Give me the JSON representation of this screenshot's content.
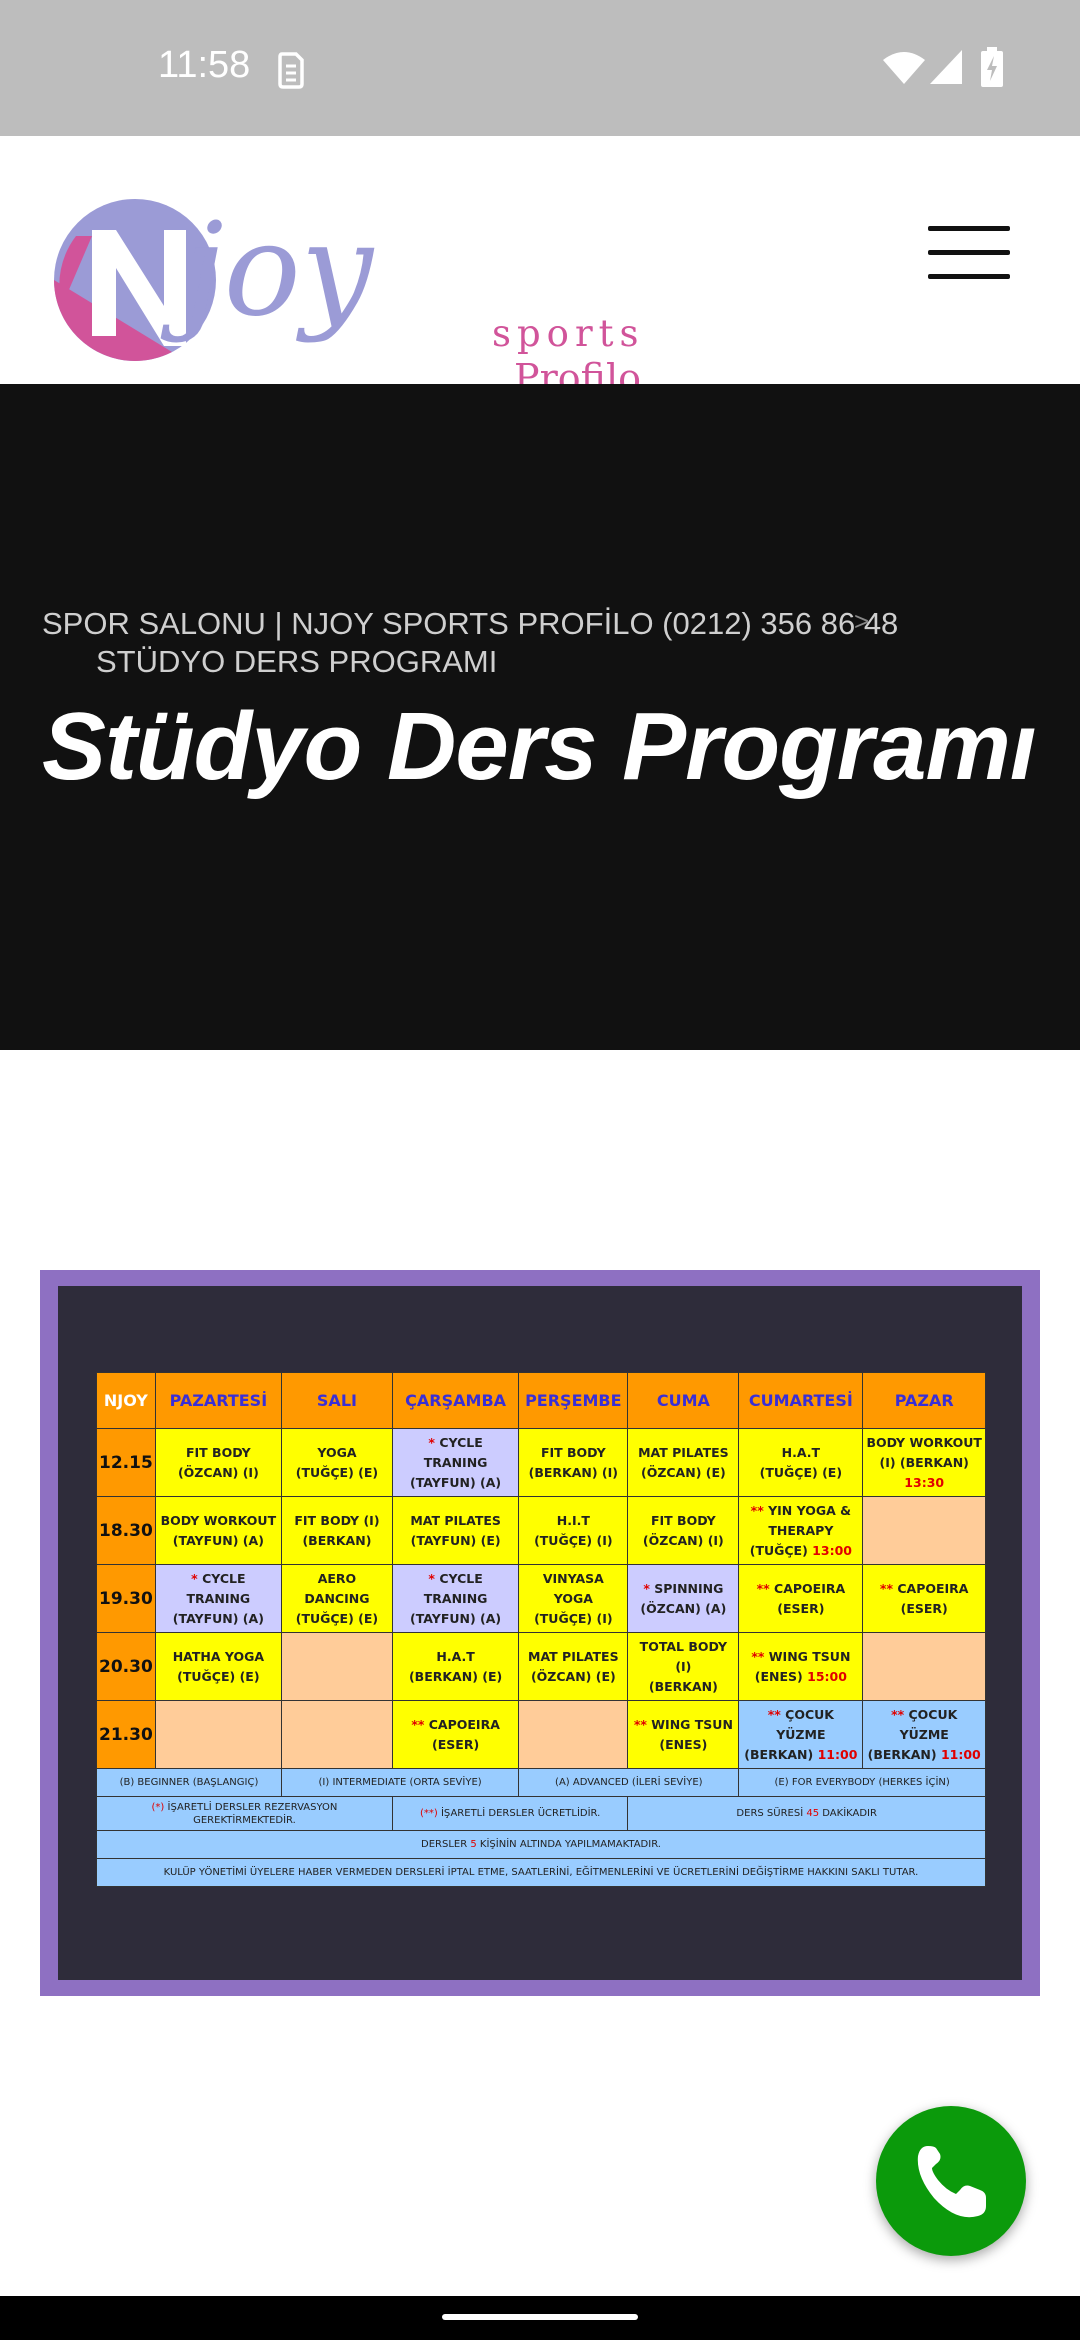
{
  "status_bar": {
    "time": "11:58"
  },
  "header": {
    "logo": {
      "word": "joy",
      "sports": "sports",
      "profilo": "Profilo"
    }
  },
  "hero": {
    "breadcrumb_home": "SPOR SALONU | NJOY SPORTS PROFİLO (0212) 356 86 48",
    "breadcrumb_separator": ">",
    "breadcrumb_current": "STÜDYO DERS PROGRAMI",
    "title": "Stüdyo Ders Programı"
  },
  "schedule": {
    "corner": "NJOY",
    "days": [
      "PAZARTESİ",
      "SALI",
      "ÇARŞAMBA",
      "PERŞEMBE",
      "CUMA",
      "CUMARTESİ",
      "PAZAR"
    ],
    "rows": [
      {
        "time": "12.15",
        "cells": [
          {
            "a": "FIT BODY",
            "b": "(ÖZCAN) (I)"
          },
          {
            "a": "YOGA",
            "b": "(TUĞÇE) (E)"
          },
          {
            "p": "*",
            "a": "CYCLE TRANING",
            "b": "(TAYFUN) (A)"
          },
          {
            "a": "FIT BODY",
            "b": "(BERKAN) (I)"
          },
          {
            "a": "MAT PILATES",
            "b": "(ÖZCAN) (E)"
          },
          {
            "a": "H.A.T",
            "b": "(TUĞÇE) (E)"
          },
          {
            "a": "BODY WORKOUT",
            "b": "(I) (BERKAN)",
            "c": "13:30"
          }
        ]
      },
      {
        "time": "18.30",
        "cells": [
          {
            "a": "BODY WORKOUT",
            "b": "(TAYFUN) (A)"
          },
          {
            "a": "FIT BODY (I)",
            "b": "(BERKAN)"
          },
          {
            "a": "MAT PILATES",
            "b": "(TAYFUN) (E)"
          },
          {
            "a": "H.I.T",
            "b": "(TUĞÇE) (I)"
          },
          {
            "a": "FIT BODY",
            "b": "(ÖZCAN) (I)"
          },
          {
            "p": "**",
            "a": "YIN YOGA &",
            "b": "THERAPY",
            "d": "(TUĞÇE)",
            "c": "13:00"
          },
          {}
        ]
      },
      {
        "time": "19.30",
        "cells": [
          {
            "p": "*",
            "a": "CYCLE TRANING",
            "b": "(TAYFUN) (A)"
          },
          {
            "a": "AERO DANCING",
            "b": "(TUĞÇE) (E)"
          },
          {
            "p": "*",
            "a": "CYCLE TRANING",
            "b": "(TAYFUN) (A)"
          },
          {
            "a": "VINYASA YOGA",
            "b": "(TUĞÇE) (I)"
          },
          {
            "p": "*",
            "a": "SPINNING",
            "b": "(ÖZCAN) (A)"
          },
          {
            "p": "**",
            "a": "CAPOEIRA",
            "b": "(ESER)"
          },
          {
            "p": "**",
            "a": "CAPOEIRA",
            "b": "(ESER)"
          }
        ]
      },
      {
        "time": "20.30",
        "cells": [
          {
            "a": "HATHA YOGA",
            "b": "(TUĞÇE) (E)"
          },
          {},
          {
            "a": "H.A.T",
            "b": "(BERKAN) (E)"
          },
          {
            "a": "MAT PILATES",
            "b": "(ÖZCAN) (E)"
          },
          {
            "a": "TOTAL BODY (I)",
            "b": "(BERKAN)"
          },
          {
            "p": "**",
            "a": "WING TSUN",
            "b": "(ENES)",
            "c": "15:00"
          },
          {}
        ]
      },
      {
        "time": "21.30",
        "cells": [
          {},
          {},
          {
            "p": "**",
            "a": "CAPOEIRA",
            "b": "(ESER)"
          },
          {},
          {
            "p": "**",
            "a": "WING TSUN",
            "b": "(ENES)"
          },
          {
            "p": "**",
            "a": "ÇOCUK YÜZME",
            "b": "(BERKAN)",
            "c": "11:00"
          },
          {
            "p": "**",
            "a": "ÇOCUK YÜZME",
            "b": "(BERKAN)",
            "c": "11:00"
          }
        ]
      }
    ],
    "legend": {
      "beginner": "(B) BEGINNER (BAŞLANGIÇ)",
      "intermediate": "(I) INTERMEDIATE (ORTA SEVİYE)",
      "advanced": "(A) ADVANCED (İLERİ SEVİYE)",
      "everybody": "(E) FOR EVERYBODY (HERKES İÇİN)"
    },
    "notes": {
      "reservation_mark": "(*)",
      "reservation": "İŞARETLİ DERSLER REZERVASYON GEREKTİRMEKTEDİR.",
      "paid_mark": "(**)",
      "paid": "İŞARETLİ DERSLER ÜCRETLİDİR.",
      "duration_pre": "DERS SÜRESİ",
      "duration_value": "45",
      "duration_post": "DAKİKADIR",
      "min_pre": "DERSLER",
      "min_value": "5",
      "min_post": "KİŞİNİN ALTINDA YAPILMAMAKTADIR.",
      "disclaimer": "KULÜP YÖNETİMİ ÜYELERE HABER VERMEDEN DERSLERİ İPTAL ETME, SAATLERİNİ, EĞİTMENLERİNİ VE ÜCRETLERİNİ DEĞİŞTİRME HAKKINI SAKLI TUTAR."
    },
    "cell_colors": [
      [
        "y",
        "y",
        "p",
        "y",
        "y",
        "y",
        "y"
      ],
      [
        "y",
        "y",
        "y",
        "y",
        "y",
        "y",
        "e"
      ],
      [
        "p",
        "y",
        "p",
        "y",
        "p",
        "y",
        "y"
      ],
      [
        "y",
        "e",
        "y",
        "y",
        "y",
        "y",
        "e"
      ],
      [
        "e",
        "e",
        "y",
        "e",
        "y",
        "b",
        "b"
      ]
    ]
  },
  "colors": {
    "hero_bg": "#111111",
    "frame": "#8e70c2",
    "accent_pink": "#d1549a",
    "accent_lavender": "#9b9bd6",
    "call_button": "#0b9a0b"
  },
  "icons": {
    "status": [
      "sim-card-icon",
      "wifi-icon",
      "signal-icon",
      "battery-charging-icon"
    ],
    "menu": "hamburger-menu-icon",
    "call": "phone-icon"
  }
}
